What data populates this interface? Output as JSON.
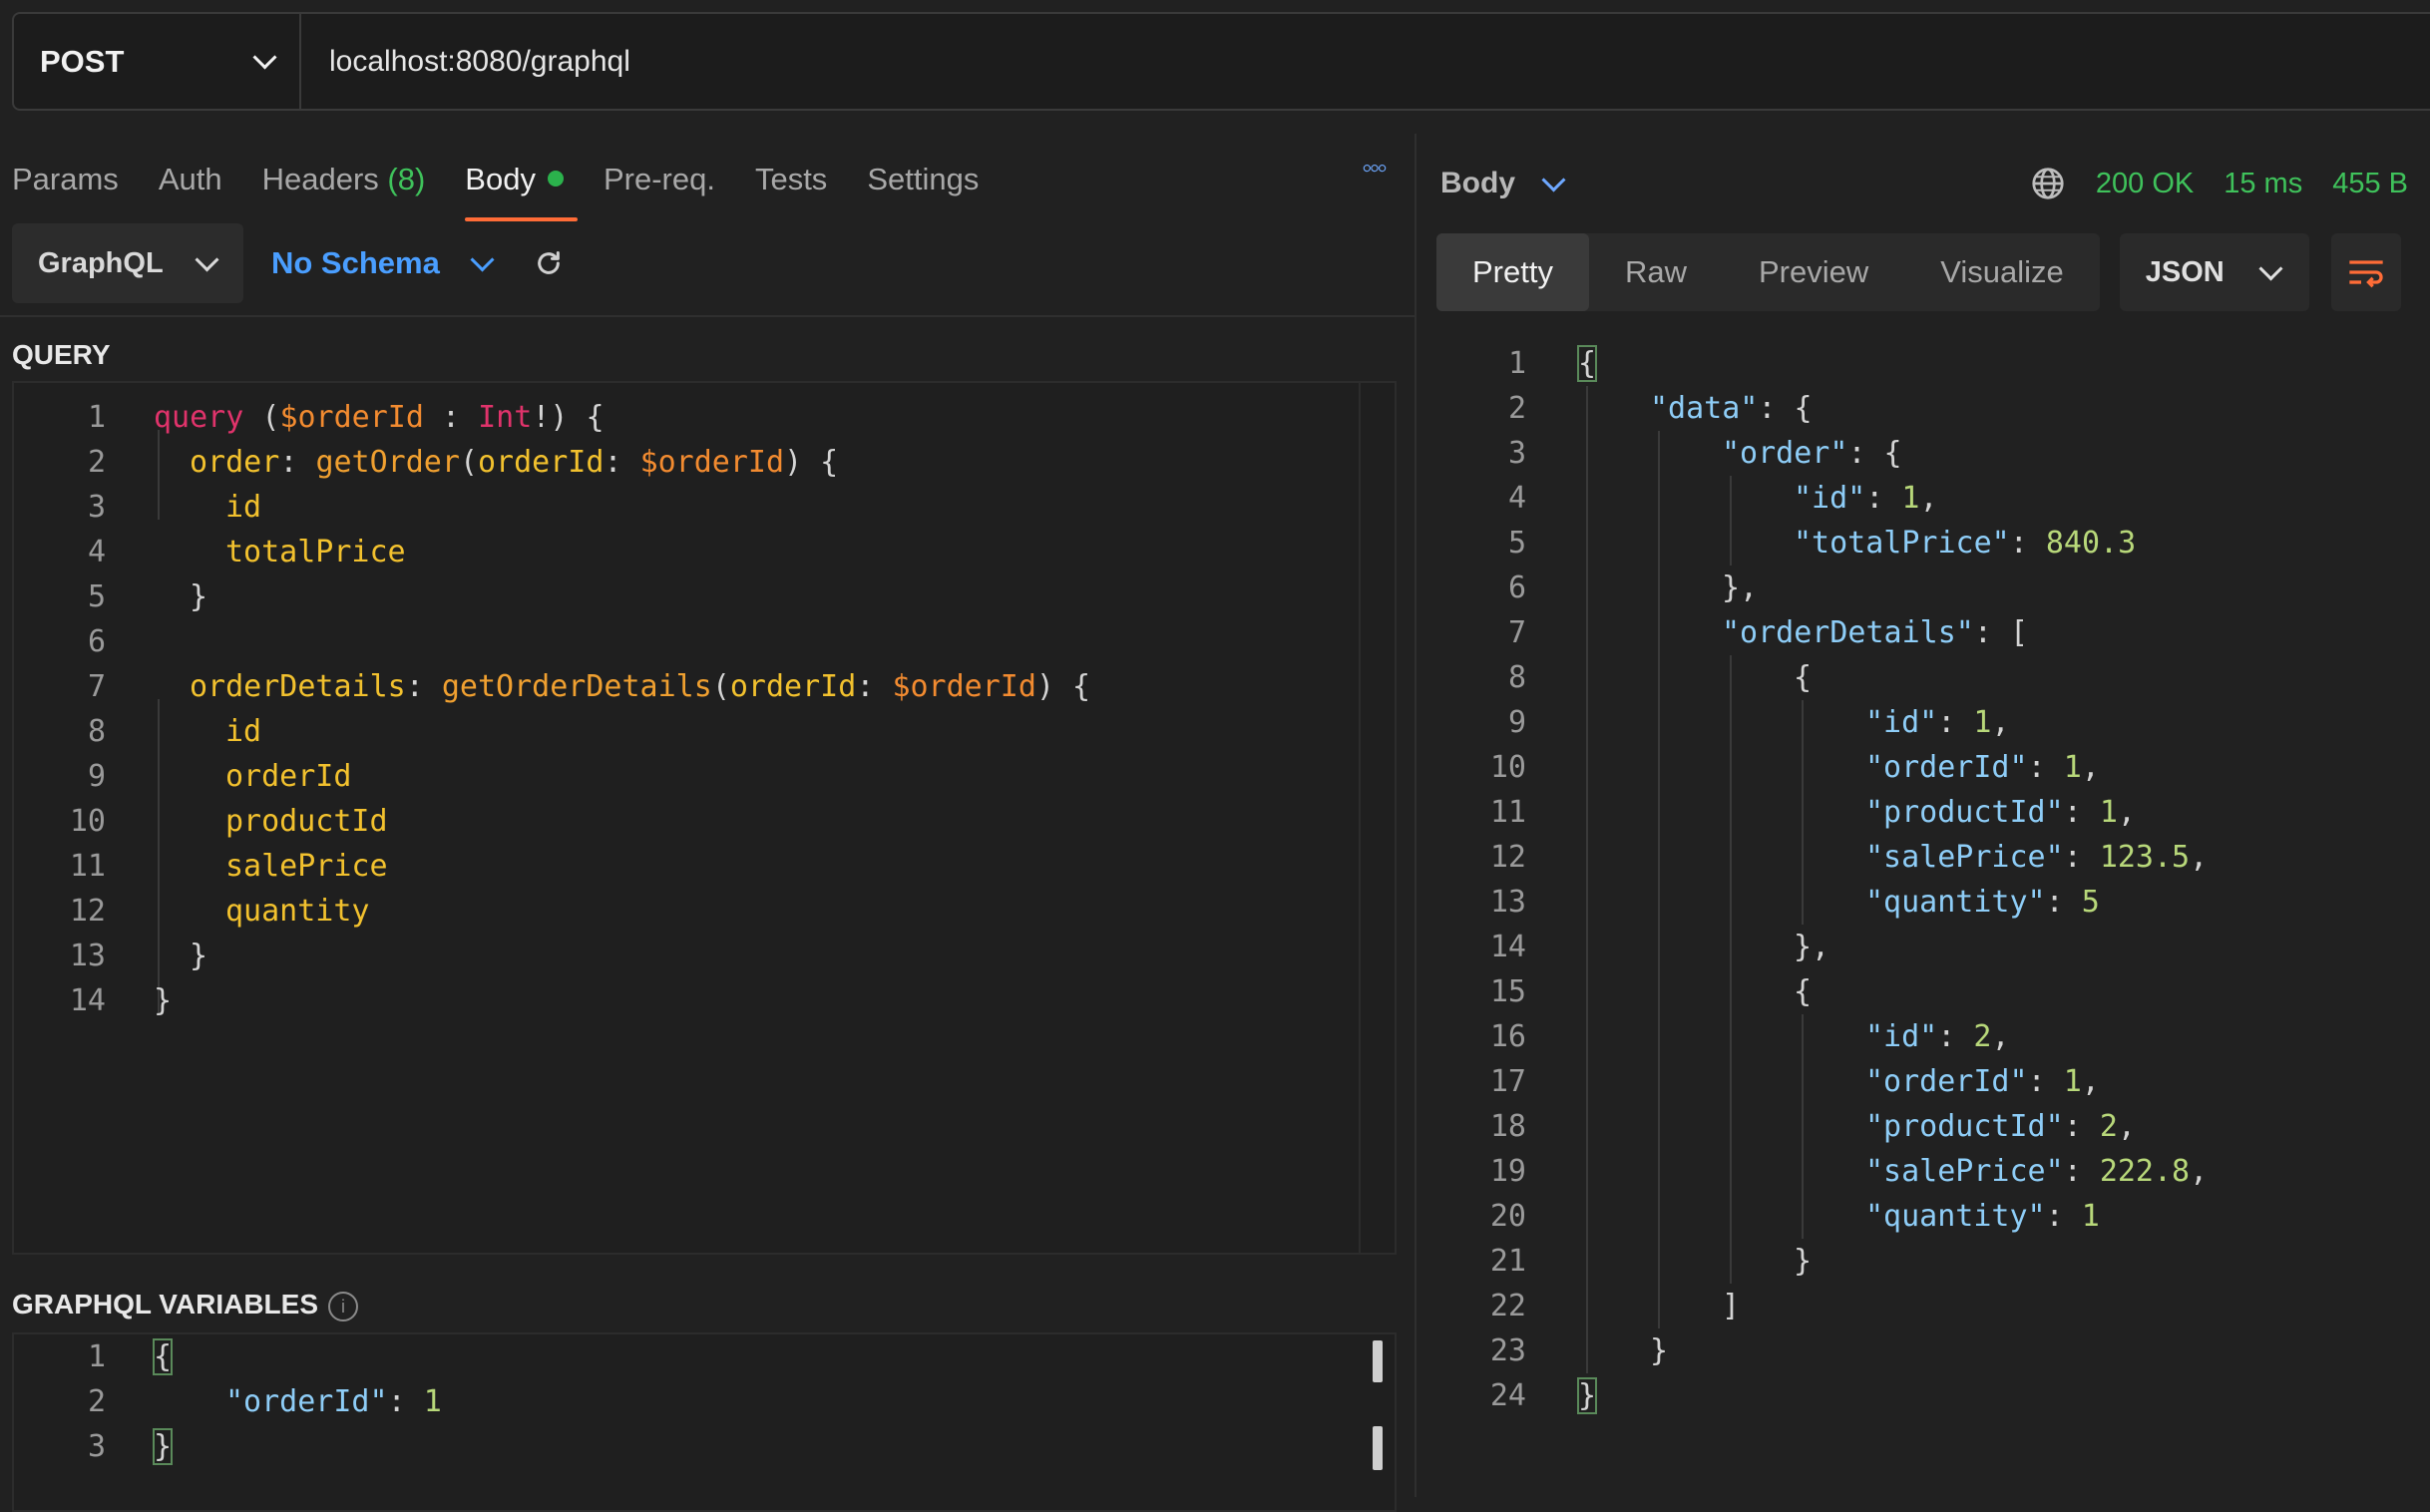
{
  "request": {
    "method": "POST",
    "url": "localhost:8080/graphql"
  },
  "request_tabs": [
    {
      "label": "Params"
    },
    {
      "label": "Auth"
    },
    {
      "label": "Headers",
      "count": "(8)"
    },
    {
      "label": "Body"
    },
    {
      "label": "Pre-req."
    },
    {
      "label": "Tests"
    },
    {
      "label": "Settings"
    }
  ],
  "more_icon": "more-horizontal-icon",
  "body_mode": "GraphQL",
  "schema": "No Schema",
  "query_label": "QUERY",
  "query_lines": [
    "1",
    "2",
    "3",
    "4",
    "5",
    "6",
    "7",
    "8",
    "9",
    "10",
    "11",
    "12",
    "13",
    "14"
  ],
  "query": {
    "l1": {
      "kw": "query",
      "p1": " (",
      "var": "$orderId",
      "p2": " : ",
      "ty": "Int",
      "p3": "!) {"
    },
    "l2": {
      "fld": "order",
      "p1": ": ",
      "fn": "getOrder",
      "p2": "(",
      "arg": "orderId",
      "p3": ": ",
      "var": "$orderId",
      "p4": ") {"
    },
    "l3": "id",
    "l4": "totalPrice",
    "l5": "}",
    "l7": {
      "fld": "orderDetails",
      "p1": ": ",
      "fn": "getOrderDetails",
      "p2": "(",
      "arg": "orderId",
      "p3": ": ",
      "var": "$orderId",
      "p4": ") {"
    },
    "l8": "id",
    "l9": "orderId",
    "l10": "productId",
    "l11": "salePrice",
    "l12": "quantity",
    "l13": "}",
    "l14": "}"
  },
  "variables_label": "GRAPHQL VARIABLES",
  "variables": {
    "l1": "{",
    "l2_key": "\"orderId\"",
    "l2_sep": ": ",
    "l2_val": "1",
    "l3": "}"
  },
  "response": {
    "body_label": "Body",
    "status": "200 OK",
    "time": "15 ms",
    "size": "455 B",
    "views": [
      "Pretty",
      "Raw",
      "Preview",
      "Visualize"
    ],
    "format": "JSON",
    "lines": [
      {
        "n": "1",
        "i": 0,
        "t": [
          [
            "pun",
            "{"
          ]
        ]
      },
      {
        "n": "2",
        "i": 1,
        "t": [
          [
            "key",
            "\"data\""
          ],
          [
            "pun",
            ": {"
          ]
        ]
      },
      {
        "n": "3",
        "i": 2,
        "t": [
          [
            "key",
            "\"order\""
          ],
          [
            "pun",
            ": {"
          ]
        ]
      },
      {
        "n": "4",
        "i": 3,
        "t": [
          [
            "key",
            "\"id\""
          ],
          [
            "pun",
            ": "
          ],
          [
            "num",
            "1"
          ],
          [
            "pun",
            ","
          ]
        ]
      },
      {
        "n": "5",
        "i": 3,
        "t": [
          [
            "key",
            "\"totalPrice\""
          ],
          [
            "pun",
            ": "
          ],
          [
            "num",
            "840.3"
          ]
        ]
      },
      {
        "n": "6",
        "i": 2,
        "t": [
          [
            "pun",
            "},"
          ]
        ]
      },
      {
        "n": "7",
        "i": 2,
        "t": [
          [
            "key",
            "\"orderDetails\""
          ],
          [
            "pun",
            ": ["
          ]
        ]
      },
      {
        "n": "8",
        "i": 3,
        "t": [
          [
            "pun",
            "{"
          ]
        ]
      },
      {
        "n": "9",
        "i": 4,
        "t": [
          [
            "key",
            "\"id\""
          ],
          [
            "pun",
            ": "
          ],
          [
            "num",
            "1"
          ],
          [
            "pun",
            ","
          ]
        ]
      },
      {
        "n": "10",
        "i": 4,
        "t": [
          [
            "key",
            "\"orderId\""
          ],
          [
            "pun",
            ": "
          ],
          [
            "num",
            "1"
          ],
          [
            "pun",
            ","
          ]
        ]
      },
      {
        "n": "11",
        "i": 4,
        "t": [
          [
            "key",
            "\"productId\""
          ],
          [
            "pun",
            ": "
          ],
          [
            "num",
            "1"
          ],
          [
            "pun",
            ","
          ]
        ]
      },
      {
        "n": "12",
        "i": 4,
        "t": [
          [
            "key",
            "\"salePrice\""
          ],
          [
            "pun",
            ": "
          ],
          [
            "num",
            "123.5"
          ],
          [
            "pun",
            ","
          ]
        ]
      },
      {
        "n": "13",
        "i": 4,
        "t": [
          [
            "key",
            "\"quantity\""
          ],
          [
            "pun",
            ": "
          ],
          [
            "num",
            "5"
          ]
        ]
      },
      {
        "n": "14",
        "i": 3,
        "t": [
          [
            "pun",
            "},"
          ]
        ]
      },
      {
        "n": "15",
        "i": 3,
        "t": [
          [
            "pun",
            "{"
          ]
        ]
      },
      {
        "n": "16",
        "i": 4,
        "t": [
          [
            "key",
            "\"id\""
          ],
          [
            "pun",
            ": "
          ],
          [
            "num",
            "2"
          ],
          [
            "pun",
            ","
          ]
        ]
      },
      {
        "n": "17",
        "i": 4,
        "t": [
          [
            "key",
            "\"orderId\""
          ],
          [
            "pun",
            ": "
          ],
          [
            "num",
            "1"
          ],
          [
            "pun",
            ","
          ]
        ]
      },
      {
        "n": "18",
        "i": 4,
        "t": [
          [
            "key",
            "\"productId\""
          ],
          [
            "pun",
            ": "
          ],
          [
            "num",
            "2"
          ],
          [
            "pun",
            ","
          ]
        ]
      },
      {
        "n": "19",
        "i": 4,
        "t": [
          [
            "key",
            "\"salePrice\""
          ],
          [
            "pun",
            ": "
          ],
          [
            "num",
            "222.8"
          ],
          [
            "pun",
            ","
          ]
        ]
      },
      {
        "n": "20",
        "i": 4,
        "t": [
          [
            "key",
            "\"quantity\""
          ],
          [
            "pun",
            ": "
          ],
          [
            "num",
            "1"
          ]
        ]
      },
      {
        "n": "21",
        "i": 3,
        "t": [
          [
            "pun",
            "}"
          ]
        ]
      },
      {
        "n": "22",
        "i": 2,
        "t": [
          [
            "pun",
            "]"
          ]
        ]
      },
      {
        "n": "23",
        "i": 1,
        "t": [
          [
            "pun",
            "}"
          ]
        ]
      },
      {
        "n": "24",
        "i": 0,
        "t": [
          [
            "pun",
            "}"
          ]
        ]
      }
    ]
  },
  "colors": {
    "accent": "#ff6c37",
    "status_ok": "#3fc25b",
    "link_blue": "#4a9eff"
  }
}
